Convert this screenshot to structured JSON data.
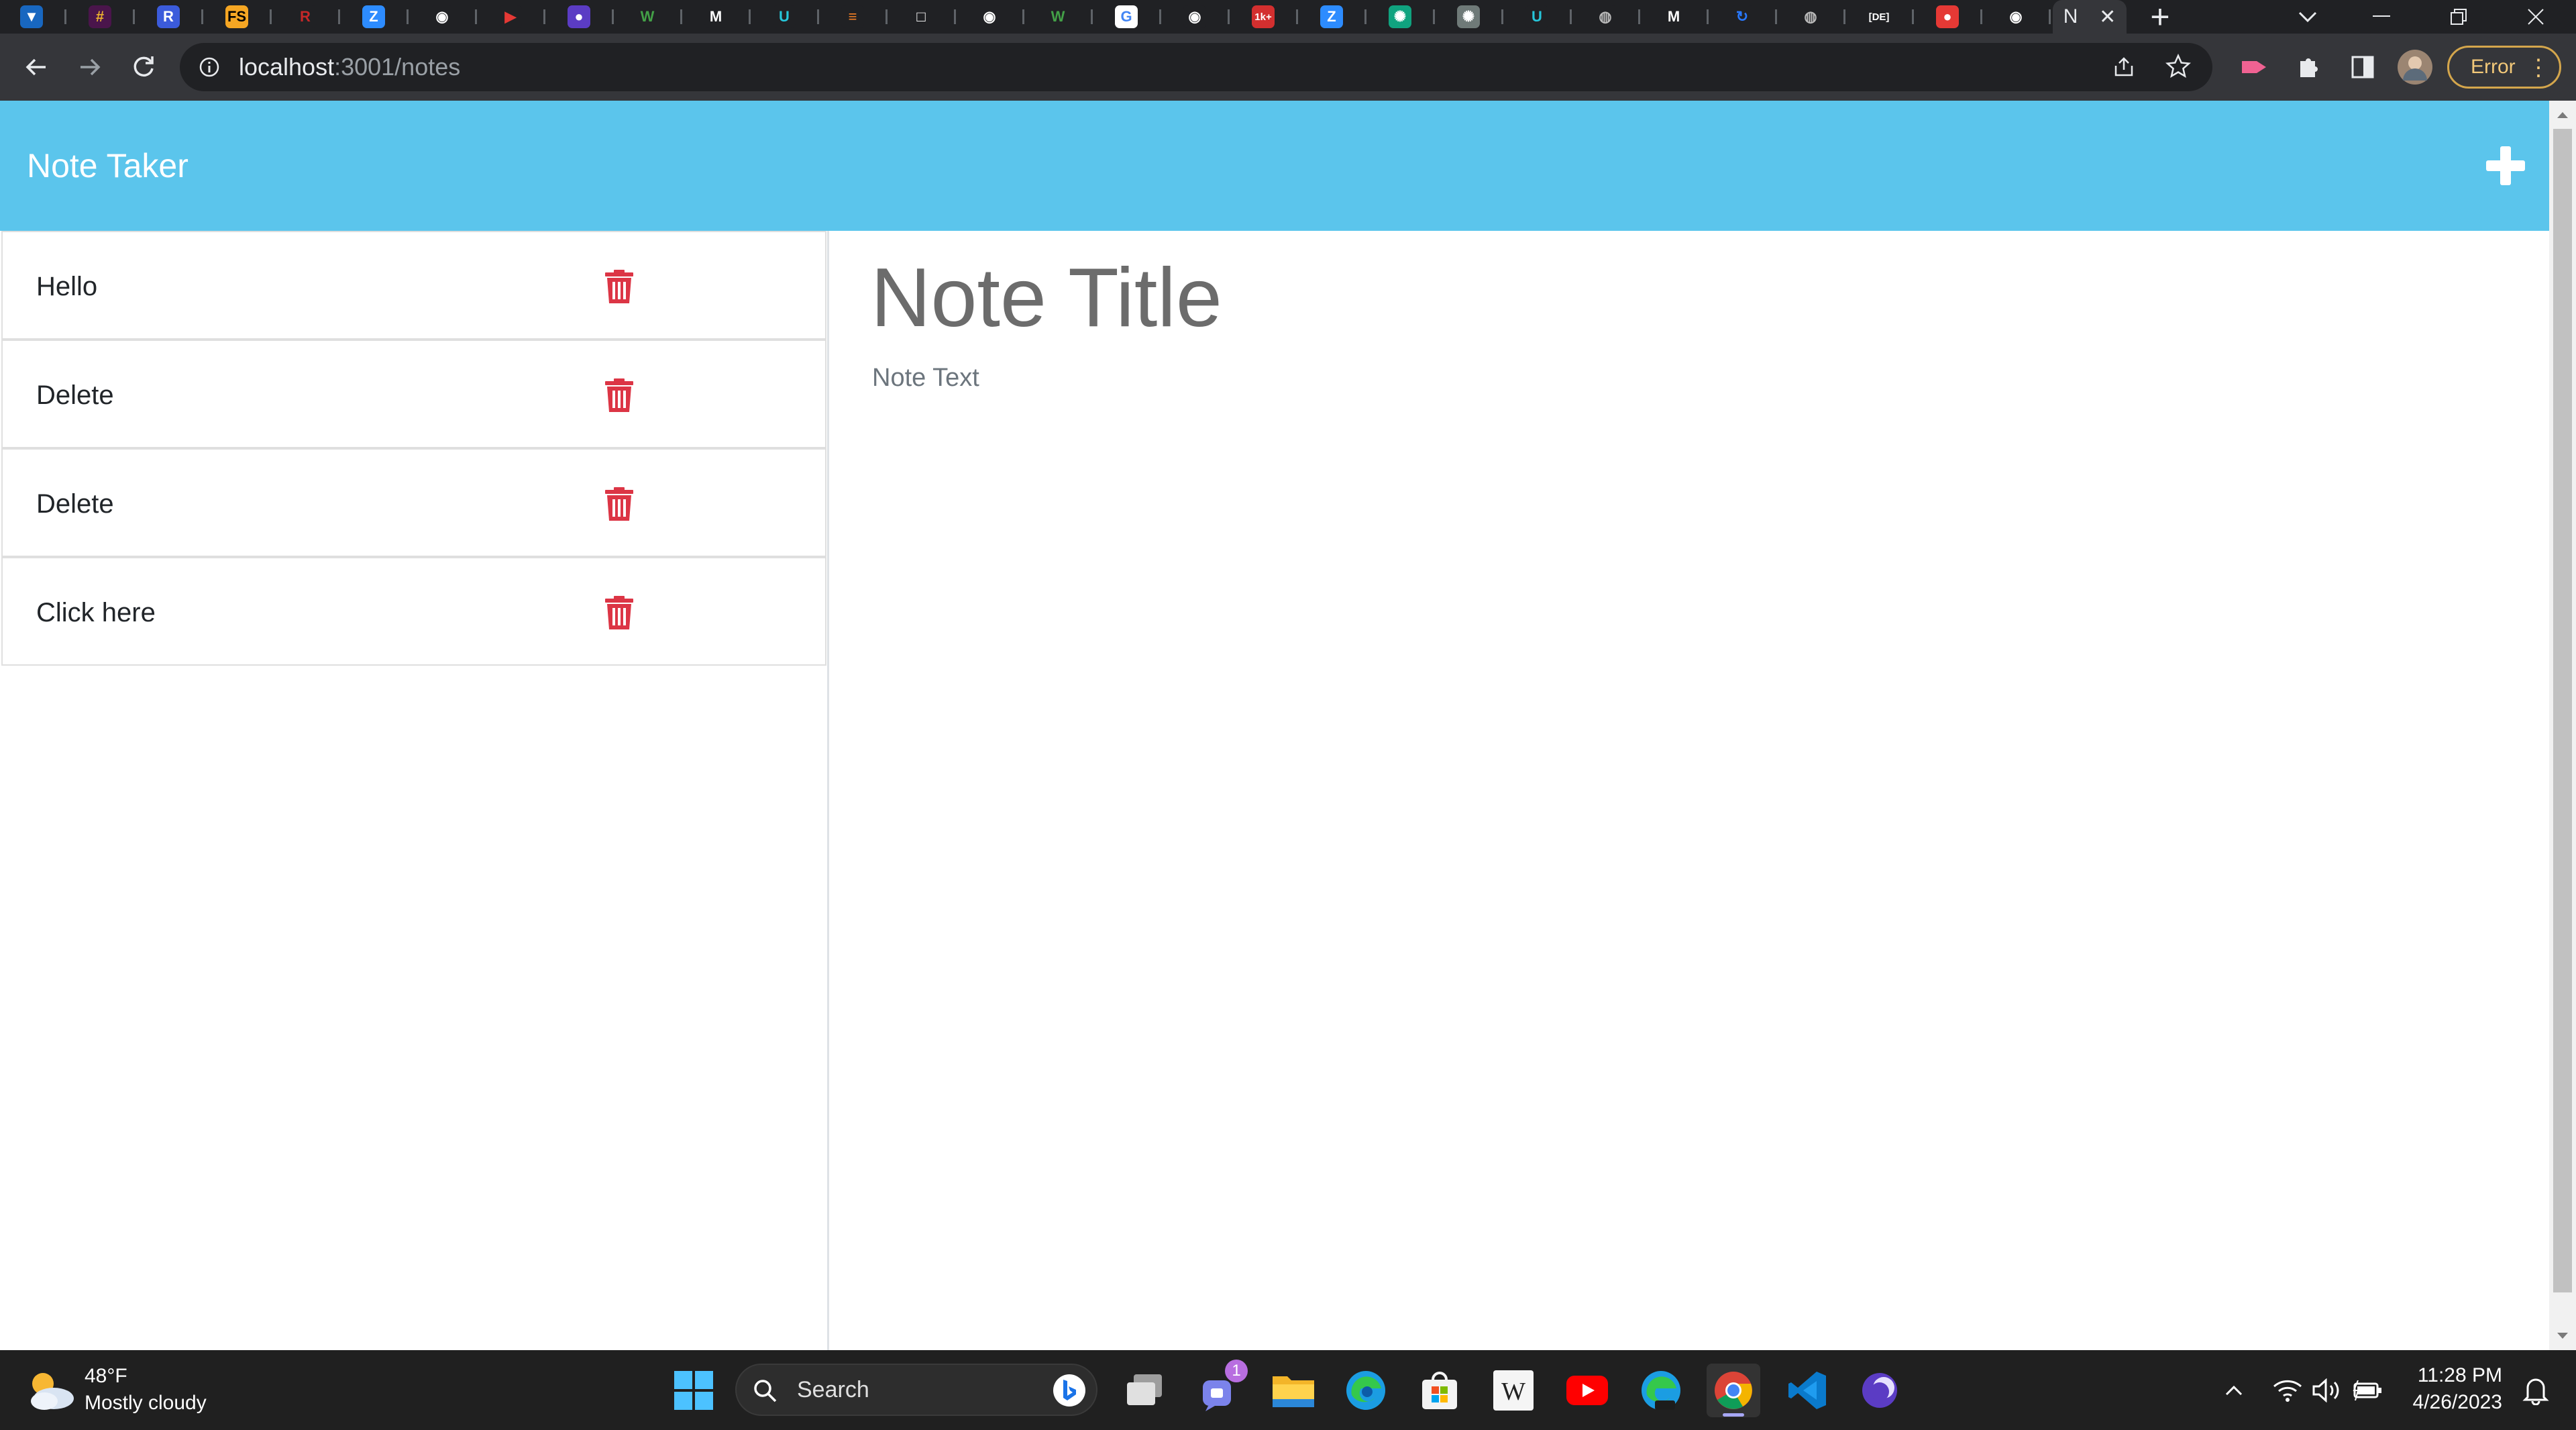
{
  "browser": {
    "active_tab_letter": "N",
    "new_tab_symbol": "+",
    "url_host": "localhost",
    "url_path": ":3001/notes",
    "profile_status": "Error",
    "tab_favicons": [
      {
        "name": "vuetify-tab",
        "glyph": "▼",
        "color": "#1867c0",
        "fg": "#fff"
      },
      {
        "name": "slack-tab",
        "glyph": "#",
        "color": "#4a154b",
        "fg": "#ecb22e"
      },
      {
        "name": "r-tab",
        "glyph": "R",
        "color": "#3b5bdb",
        "fg": "#fff"
      },
      {
        "name": "fs-tab",
        "glyph": "FS",
        "color": "#f5a623",
        "fg": "#000"
      },
      {
        "name": "r-red-tab",
        "glyph": "R",
        "color": "#202124",
        "fg": "#c62828"
      },
      {
        "name": "zoom-tab",
        "glyph": "Z",
        "color": "#2d8cff",
        "fg": "#fff"
      },
      {
        "name": "github-tab",
        "glyph": "◉",
        "color": "#202124",
        "fg": "#fff"
      },
      {
        "name": "video-tab",
        "glyph": "▶",
        "color": "#202124",
        "fg": "#e53935"
      },
      {
        "name": "purple-tab",
        "glyph": "●",
        "color": "#5b3cc4",
        "fg": "#fff"
      },
      {
        "name": "w-tab",
        "glyph": "W",
        "color": "#202124",
        "fg": "#43a047"
      },
      {
        "name": "m-tab",
        "glyph": "M",
        "color": "#202124",
        "fg": "#fff"
      },
      {
        "name": "u-tab",
        "glyph": "U",
        "color": "#202124",
        "fg": "#26c6da"
      },
      {
        "name": "stack-tab",
        "glyph": "≡",
        "color": "#202124",
        "fg": "#f48024"
      },
      {
        "name": "square-tab",
        "glyph": "□",
        "color": "#202124",
        "fg": "#fff"
      },
      {
        "name": "github-tab-2",
        "glyph": "◉",
        "color": "#202124",
        "fg": "#fff"
      },
      {
        "name": "w-tab-2",
        "glyph": "W",
        "color": "#202124",
        "fg": "#43a047"
      },
      {
        "name": "google-tab",
        "glyph": "G",
        "color": "#fff",
        "fg": "#4285f4"
      },
      {
        "name": "github-tab-3",
        "glyph": "◉",
        "color": "#202124",
        "fg": "#fff"
      },
      {
        "name": "count-tab",
        "glyph": "1k+",
        "color": "#d32f2f",
        "fg": "#fff"
      },
      {
        "name": "zoom-tab-2",
        "glyph": "Z",
        "color": "#2d8cff",
        "fg": "#fff"
      },
      {
        "name": "chatgpt-tab",
        "glyph": "✺",
        "color": "#10a37f",
        "fg": "#fff"
      },
      {
        "name": "chatgpt-tab-2",
        "glyph": "✺",
        "color": "#6f7a78",
        "fg": "#fff"
      },
      {
        "name": "u-tab-2",
        "glyph": "U",
        "color": "#202124",
        "fg": "#26c6da"
      },
      {
        "name": "globe-tab",
        "glyph": "◍",
        "color": "#202124",
        "fg": "#bbb"
      },
      {
        "name": "m-tab-2",
        "glyph": "M",
        "color": "#202124",
        "fg": "#fff"
      },
      {
        "name": "loop-tab",
        "glyph": "↻",
        "color": "#202124",
        "fg": "#2979ff"
      },
      {
        "name": "globe-tab-2",
        "glyph": "◍",
        "color": "#202124",
        "fg": "#bbb"
      },
      {
        "name": "de-tab",
        "glyph": "[DE]",
        "color": "#202124",
        "fg": "#fff"
      },
      {
        "name": "red-tab",
        "glyph": "●",
        "color": "#e53935",
        "fg": "#fff"
      },
      {
        "name": "github-tab-4",
        "glyph": "◉",
        "color": "#202124",
        "fg": "#fff"
      }
    ]
  },
  "app": {
    "brand": "Note Taker",
    "notes": [
      {
        "title": "Hello"
      },
      {
        "title": "Delete"
      },
      {
        "title": "Delete"
      },
      {
        "title": "Click here"
      }
    ],
    "editor": {
      "title_placeholder": "Note Title",
      "text_placeholder": "Note Text"
    },
    "colors": {
      "navbar": "#5bc5ec",
      "trash": "#dc3545"
    }
  },
  "taskbar": {
    "weather_temp": "48°F",
    "weather_desc": "Mostly cloudy",
    "search_label": "Search",
    "teams_badge": "1",
    "time": "11:28 PM",
    "date": "4/26/2023"
  }
}
